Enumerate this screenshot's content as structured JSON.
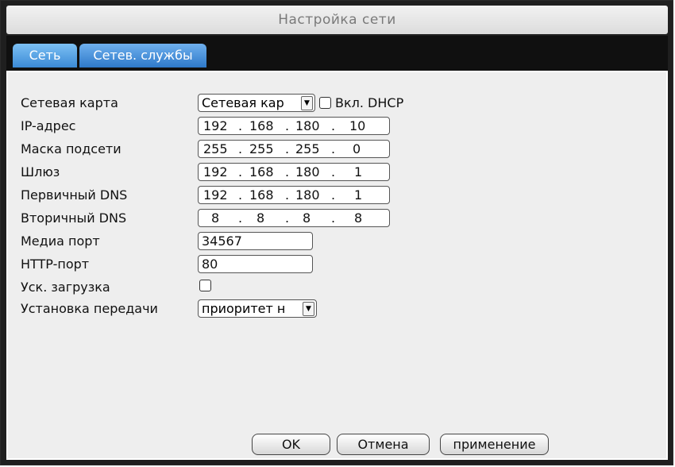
{
  "window": {
    "title": "Настройка сети"
  },
  "tabs": [
    {
      "label": "Сеть",
      "active": true
    },
    {
      "label": "Сетев. службы",
      "active": false
    }
  ],
  "form": {
    "network_card": {
      "label": "Сетевая карта",
      "value": "Сетевая кар"
    },
    "dhcp": {
      "label": "Вкл. DHCP",
      "checked": false
    },
    "ip": {
      "label": "IP-адрес",
      "octets": [
        "192",
        "168",
        "180",
        "10"
      ]
    },
    "mask": {
      "label": "Маска подсети",
      "octets": [
        "255",
        "255",
        "255",
        "0"
      ]
    },
    "gateway": {
      "label": "Шлюз",
      "octets": [
        "192",
        "168",
        "180",
        "1"
      ]
    },
    "dns1": {
      "label": "Первичный DNS",
      "octets": [
        "192",
        "168",
        "180",
        "1"
      ]
    },
    "dns2": {
      "label": "Вторичный DNS",
      "octets": [
        "8",
        "8",
        "8",
        "8"
      ]
    },
    "media_port": {
      "label": "Медиа порт",
      "value": "34567"
    },
    "http_port": {
      "label": "HTTP-порт",
      "value": "80"
    },
    "fast_boot": {
      "label": "Уск. загрузка",
      "checked": false
    },
    "transfer": {
      "label": "Установка передачи",
      "value": "приоритет н"
    }
  },
  "buttons": {
    "ok": "OK",
    "cancel": "Отмена",
    "apply": "применение"
  },
  "colors": {
    "tab_blue": "#3b8ad6",
    "panel": "#eeeeee",
    "title_text": "#7a7a7a"
  }
}
